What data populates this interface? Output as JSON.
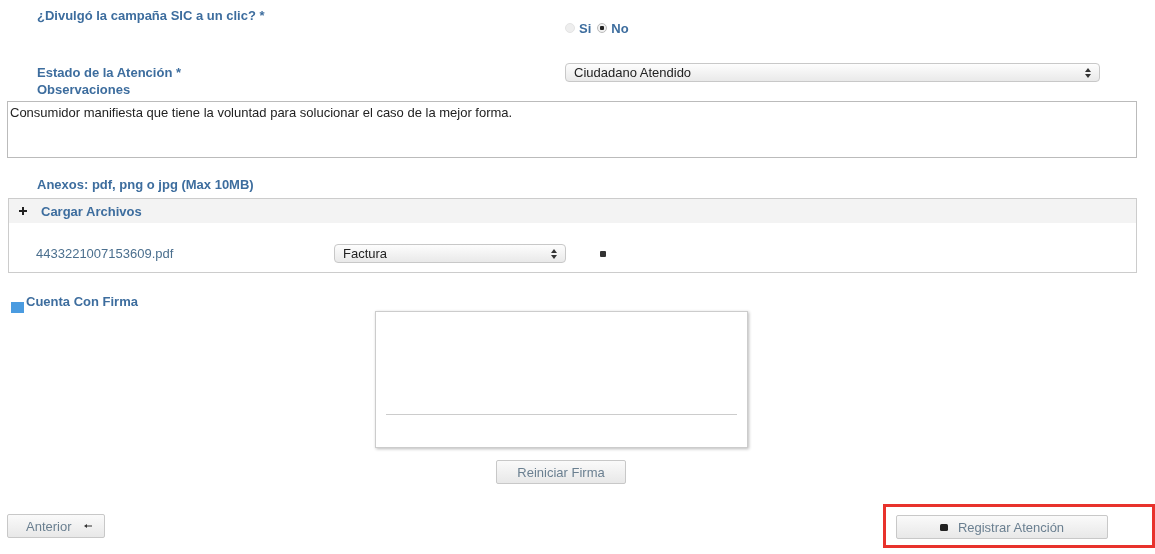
{
  "campaign_question": {
    "label": "¿Divulgó la campaña SIC a un clic? *",
    "options": [
      {
        "label": "Si",
        "selected": false
      },
      {
        "label": "No",
        "selected": true
      }
    ]
  },
  "status_question": {
    "label": "Estado de la Atención *",
    "value": "Ciudadano Atendido"
  },
  "observations": {
    "label": "Observaciones",
    "value": "Consumidor manifiesta que tiene la voluntad para solucionar el caso de la mejor forma."
  },
  "attachments": {
    "label": "Anexos: pdf, png o jpg (Max 10MB)",
    "panel_title": "Cargar Archivos",
    "files": [
      {
        "name": "4433221007153609.pdf",
        "type": "Factura"
      }
    ]
  },
  "signature": {
    "label": "Cuenta Con Firma",
    "checked": true,
    "reset_button": "Reiniciar Firma"
  },
  "footer": {
    "back_button": "Anterior",
    "submit_button": "Registrar Atención",
    "submit_highlighted": true
  }
}
